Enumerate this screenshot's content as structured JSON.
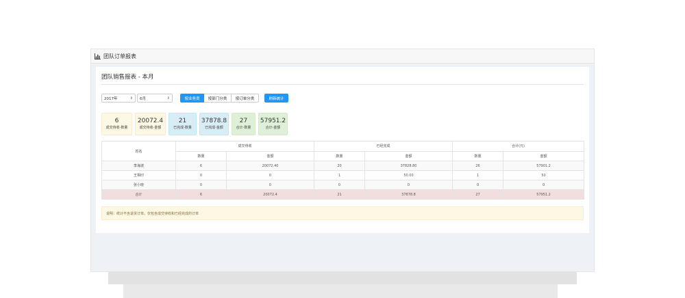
{
  "window": {
    "title": "团队订单报表"
  },
  "panel": {
    "title": "团队销售报表 - 本月"
  },
  "filters": {
    "year": "2017年",
    "month": "6月"
  },
  "tabs": [
    {
      "label": "按业务员",
      "active": true
    },
    {
      "label": "按部门分类",
      "active": false
    },
    {
      "label": "按订单分类",
      "active": false
    }
  ],
  "refresh_label": "刷新统计",
  "stats": [
    {
      "value": "6",
      "label": "成交待收-数量",
      "color": "yellow"
    },
    {
      "value": "20072.4",
      "label": "成交待收-金额",
      "color": "yellow"
    },
    {
      "value": "21",
      "label": "已完成-数量",
      "color": "blue"
    },
    {
      "value": "37878.8",
      "label": "已完成-金额",
      "color": "blue"
    },
    {
      "value": "27",
      "label": "合计-数量",
      "color": "green"
    },
    {
      "value": "57951.2",
      "label": "合计-金额",
      "color": "green"
    }
  ],
  "table": {
    "name_header": "姓名",
    "groups": [
      "成交待收",
      "已经完成",
      "合计(元)"
    ],
    "sub_headers": [
      "数量",
      "金额",
      "数量",
      "金额",
      "数量",
      "金额"
    ],
    "rows": [
      [
        "李海波",
        "6",
        "20072.40",
        "20",
        "37828.80",
        "26",
        "57901.2"
      ],
      [
        "王相印",
        "0",
        "0",
        "1",
        "50.00",
        "1",
        "50"
      ],
      [
        "张小晓",
        "0",
        "0",
        "0",
        "0",
        "0",
        "0"
      ]
    ],
    "total": [
      "合计",
      "6",
      "20072.4",
      "21",
      "37878.8",
      "27",
      "57951.2"
    ]
  },
  "note": "说明：统计不含退货订单。仅包含成交待收和已经完成的订单",
  "colors": {
    "accent": "#2196f3",
    "total_row": "#f2dede",
    "note_bg": "#fcf8e3"
  }
}
